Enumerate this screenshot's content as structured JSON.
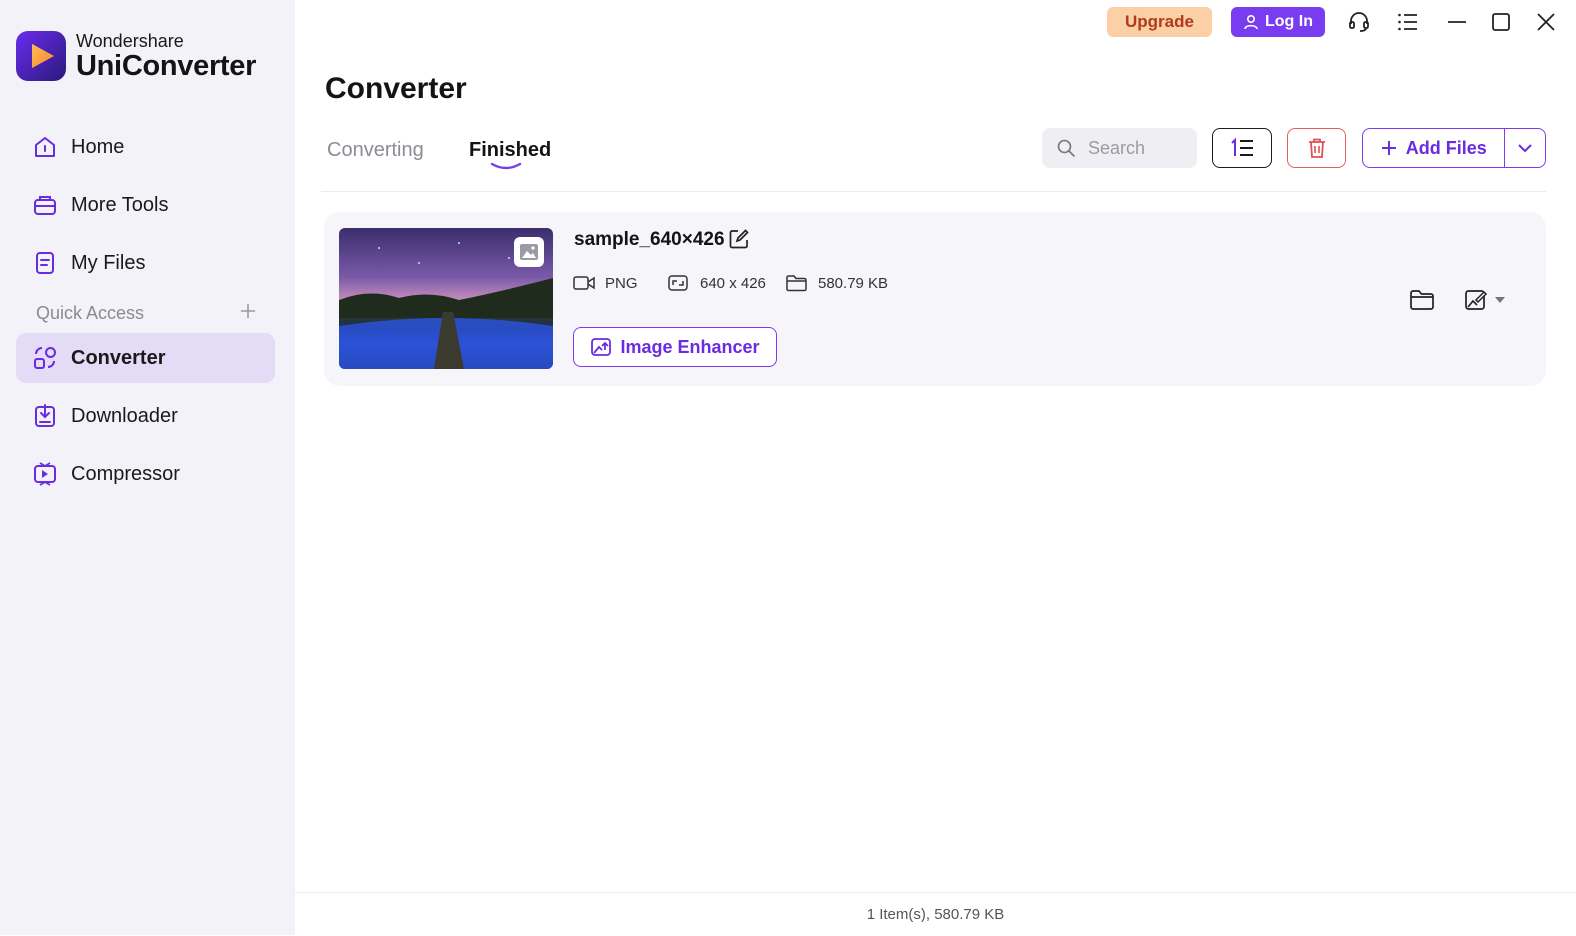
{
  "app": {
    "brand_top": "Wondershare",
    "brand_main": "UniConverter"
  },
  "titlebar": {
    "upgrade_label": "Upgrade",
    "login_label": "Log In",
    "icons": [
      "headset-icon",
      "menu-list-icon",
      "minimize-icon",
      "maximize-icon",
      "close-icon"
    ]
  },
  "sidebar": {
    "items": [
      {
        "label": "Home",
        "icon": "home-icon"
      },
      {
        "label": "More Tools",
        "icon": "toolbox-icon"
      },
      {
        "label": "My Files",
        "icon": "file-icon"
      }
    ],
    "quick_access_label": "Quick Access",
    "quick_items": [
      {
        "label": "Converter",
        "icon": "converter-icon",
        "active": true
      },
      {
        "label": "Downloader",
        "icon": "downloader-icon"
      },
      {
        "label": "Compressor",
        "icon": "compressor-icon"
      }
    ]
  },
  "main": {
    "title": "Converter",
    "tabs": [
      {
        "label": "Converting",
        "active": false
      },
      {
        "label": "Finished",
        "active": true
      }
    ],
    "search": {
      "placeholder": "Search",
      "value": ""
    },
    "add_files_label": "Add Files"
  },
  "file": {
    "name": "sample_640×426",
    "format": "PNG",
    "resolution": "640 x 426",
    "size": "580.79 KB",
    "enhancer_label": "Image Enhancer"
  },
  "status": {
    "summary": "1 Item(s), 580.79 KB"
  },
  "colors": {
    "accent": "#7a3cf0",
    "upgrade_bg": "#fbd0a6",
    "upgrade_text": "#b23b1e",
    "sidebar_bg": "#f3f2f9",
    "active_bg": "#e4dcf7",
    "delete": "#e06060"
  }
}
